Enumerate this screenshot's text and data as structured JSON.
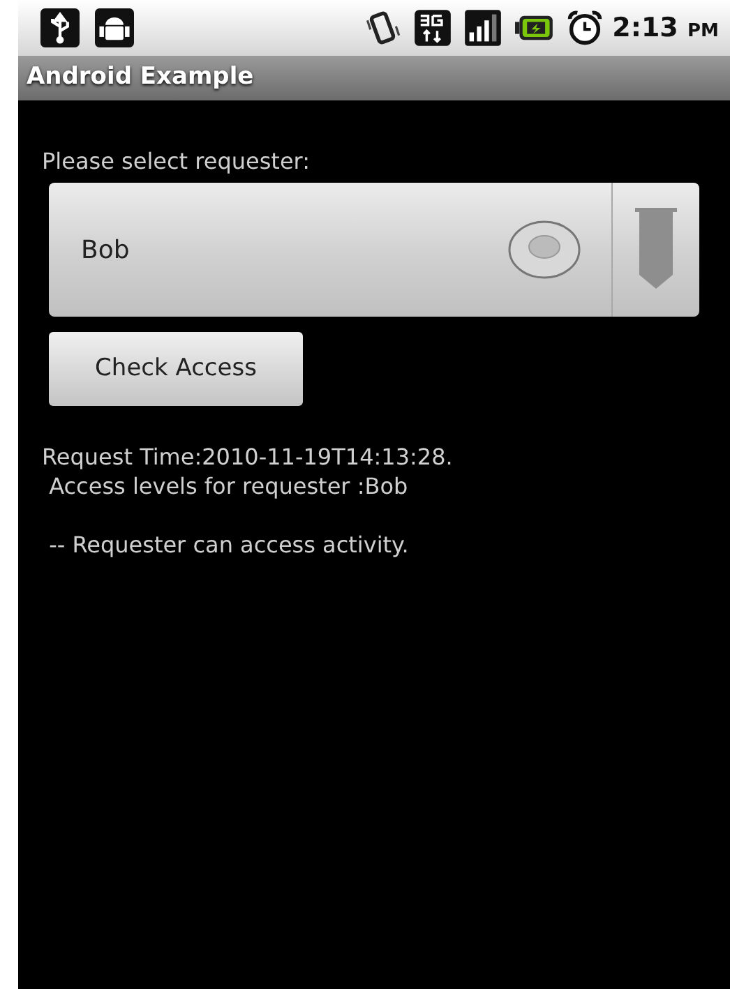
{
  "status_bar": {
    "time": "2:13",
    "meridiem": "PM"
  },
  "title_bar": {
    "title": "Android Example"
  },
  "requester_label": "Please select requester:",
  "spinner": {
    "value": "Bob"
  },
  "check_button": {
    "label": "Check Access"
  },
  "result_lines": [
    "Request Time:2010-11-19T14:13:28.",
    " Access levels for requester :Bob",
    " -- Requester can access activity."
  ]
}
